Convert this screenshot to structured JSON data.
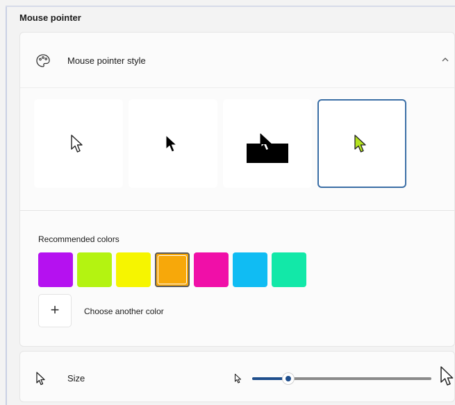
{
  "section": {
    "title": "Mouse pointer"
  },
  "pointer_style": {
    "label": "Mouse pointer style",
    "icon": "palette-icon",
    "expanded": true,
    "options": [
      {
        "name": "white",
        "icon": "pointer-white-icon",
        "selected": false
      },
      {
        "name": "black",
        "icon": "pointer-black-icon",
        "selected": false
      },
      {
        "name": "inverted",
        "icon": "pointer-inverted-icon",
        "selected": false
      },
      {
        "name": "custom",
        "icon": "pointer-custom-icon",
        "selected": true
      }
    ],
    "custom_color": "#b4e31f"
  },
  "colors": {
    "label": "Recommended colors",
    "swatches": [
      {
        "color": "#b511f0",
        "selected": false
      },
      {
        "color": "#b4f311",
        "selected": false
      },
      {
        "color": "#f6f500",
        "selected": false
      },
      {
        "color": "#f7a80a",
        "selected": true
      },
      {
        "color": "#f00fa8",
        "selected": false
      },
      {
        "color": "#10bcf3",
        "selected": false
      },
      {
        "color": "#12e8a8",
        "selected": false
      }
    ],
    "add_label": "Choose another color",
    "add_symbol": "+"
  },
  "size": {
    "label": "Size",
    "icon": "pointer-size-icon",
    "value_fraction": 0.2
  },
  "accent_color": "#1f4e8c"
}
